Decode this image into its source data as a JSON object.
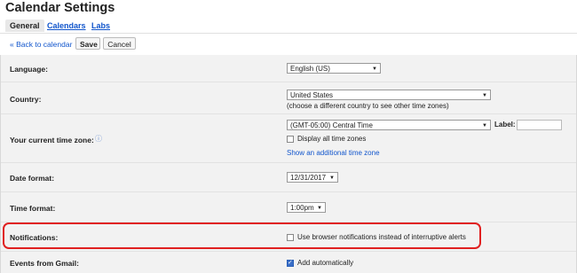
{
  "header": {
    "title": "Calendar Settings"
  },
  "tabs": [
    {
      "label": "General",
      "active": true
    },
    {
      "label": "Calendars",
      "active": false
    },
    {
      "label": "Labs",
      "active": false
    }
  ],
  "toolbar": {
    "back_label": "« Back to calendar",
    "save_label": "Save",
    "cancel_label": "Cancel"
  },
  "settings": {
    "language": {
      "label": "Language:",
      "value": "English (US)"
    },
    "country": {
      "label": "Country:",
      "value": "United States",
      "hint": "(choose a different country to see other time zones)"
    },
    "timezone": {
      "label": "Your current time zone:",
      "value": "(GMT-05:00) Central Time",
      "label_field": "Label:",
      "display_all": "Display all time zones",
      "additional_link": "Show an additional time zone"
    },
    "date_format": {
      "label": "Date format:",
      "value": "12/31/2017"
    },
    "time_format": {
      "label": "Time format:",
      "value": "1:00pm"
    },
    "notifications": {
      "label": "Notifications:",
      "option": "Use browser notifications instead of interruptive alerts",
      "checked": false
    },
    "events_gmail": {
      "label": "Events from Gmail:",
      "option": "Add automatically",
      "checked": true
    }
  },
  "colors": {
    "link": "#1155cc",
    "highlight": "#e02020",
    "panel": "#f2f2f2"
  }
}
